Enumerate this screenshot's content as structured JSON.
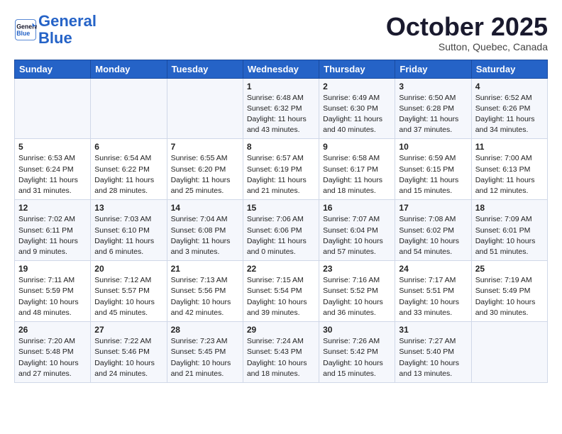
{
  "header": {
    "logo_line1": "General",
    "logo_line2": "Blue",
    "month": "October 2025",
    "location": "Sutton, Quebec, Canada"
  },
  "weekdays": [
    "Sunday",
    "Monday",
    "Tuesday",
    "Wednesday",
    "Thursday",
    "Friday",
    "Saturday"
  ],
  "weeks": [
    [
      {
        "num": "",
        "info": ""
      },
      {
        "num": "",
        "info": ""
      },
      {
        "num": "",
        "info": ""
      },
      {
        "num": "1",
        "info": "Sunrise: 6:48 AM\nSunset: 6:32 PM\nDaylight: 11 hours\nand 43 minutes."
      },
      {
        "num": "2",
        "info": "Sunrise: 6:49 AM\nSunset: 6:30 PM\nDaylight: 11 hours\nand 40 minutes."
      },
      {
        "num": "3",
        "info": "Sunrise: 6:50 AM\nSunset: 6:28 PM\nDaylight: 11 hours\nand 37 minutes."
      },
      {
        "num": "4",
        "info": "Sunrise: 6:52 AM\nSunset: 6:26 PM\nDaylight: 11 hours\nand 34 minutes."
      }
    ],
    [
      {
        "num": "5",
        "info": "Sunrise: 6:53 AM\nSunset: 6:24 PM\nDaylight: 11 hours\nand 31 minutes."
      },
      {
        "num": "6",
        "info": "Sunrise: 6:54 AM\nSunset: 6:22 PM\nDaylight: 11 hours\nand 28 minutes."
      },
      {
        "num": "7",
        "info": "Sunrise: 6:55 AM\nSunset: 6:20 PM\nDaylight: 11 hours\nand 25 minutes."
      },
      {
        "num": "8",
        "info": "Sunrise: 6:57 AM\nSunset: 6:19 PM\nDaylight: 11 hours\nand 21 minutes."
      },
      {
        "num": "9",
        "info": "Sunrise: 6:58 AM\nSunset: 6:17 PM\nDaylight: 11 hours\nand 18 minutes."
      },
      {
        "num": "10",
        "info": "Sunrise: 6:59 AM\nSunset: 6:15 PM\nDaylight: 11 hours\nand 15 minutes."
      },
      {
        "num": "11",
        "info": "Sunrise: 7:00 AM\nSunset: 6:13 PM\nDaylight: 11 hours\nand 12 minutes."
      }
    ],
    [
      {
        "num": "12",
        "info": "Sunrise: 7:02 AM\nSunset: 6:11 PM\nDaylight: 11 hours\nand 9 minutes."
      },
      {
        "num": "13",
        "info": "Sunrise: 7:03 AM\nSunset: 6:10 PM\nDaylight: 11 hours\nand 6 minutes."
      },
      {
        "num": "14",
        "info": "Sunrise: 7:04 AM\nSunset: 6:08 PM\nDaylight: 11 hours\nand 3 minutes."
      },
      {
        "num": "15",
        "info": "Sunrise: 7:06 AM\nSunset: 6:06 PM\nDaylight: 11 hours\nand 0 minutes."
      },
      {
        "num": "16",
        "info": "Sunrise: 7:07 AM\nSunset: 6:04 PM\nDaylight: 10 hours\nand 57 minutes."
      },
      {
        "num": "17",
        "info": "Sunrise: 7:08 AM\nSunset: 6:02 PM\nDaylight: 10 hours\nand 54 minutes."
      },
      {
        "num": "18",
        "info": "Sunrise: 7:09 AM\nSunset: 6:01 PM\nDaylight: 10 hours\nand 51 minutes."
      }
    ],
    [
      {
        "num": "19",
        "info": "Sunrise: 7:11 AM\nSunset: 5:59 PM\nDaylight: 10 hours\nand 48 minutes."
      },
      {
        "num": "20",
        "info": "Sunrise: 7:12 AM\nSunset: 5:57 PM\nDaylight: 10 hours\nand 45 minutes."
      },
      {
        "num": "21",
        "info": "Sunrise: 7:13 AM\nSunset: 5:56 PM\nDaylight: 10 hours\nand 42 minutes."
      },
      {
        "num": "22",
        "info": "Sunrise: 7:15 AM\nSunset: 5:54 PM\nDaylight: 10 hours\nand 39 minutes."
      },
      {
        "num": "23",
        "info": "Sunrise: 7:16 AM\nSunset: 5:52 PM\nDaylight: 10 hours\nand 36 minutes."
      },
      {
        "num": "24",
        "info": "Sunrise: 7:17 AM\nSunset: 5:51 PM\nDaylight: 10 hours\nand 33 minutes."
      },
      {
        "num": "25",
        "info": "Sunrise: 7:19 AM\nSunset: 5:49 PM\nDaylight: 10 hours\nand 30 minutes."
      }
    ],
    [
      {
        "num": "26",
        "info": "Sunrise: 7:20 AM\nSunset: 5:48 PM\nDaylight: 10 hours\nand 27 minutes."
      },
      {
        "num": "27",
        "info": "Sunrise: 7:22 AM\nSunset: 5:46 PM\nDaylight: 10 hours\nand 24 minutes."
      },
      {
        "num": "28",
        "info": "Sunrise: 7:23 AM\nSunset: 5:45 PM\nDaylight: 10 hours\nand 21 minutes."
      },
      {
        "num": "29",
        "info": "Sunrise: 7:24 AM\nSunset: 5:43 PM\nDaylight: 10 hours\nand 18 minutes."
      },
      {
        "num": "30",
        "info": "Sunrise: 7:26 AM\nSunset: 5:42 PM\nDaylight: 10 hours\nand 15 minutes."
      },
      {
        "num": "31",
        "info": "Sunrise: 7:27 AM\nSunset: 5:40 PM\nDaylight: 10 hours\nand 13 minutes."
      },
      {
        "num": "",
        "info": ""
      }
    ]
  ]
}
